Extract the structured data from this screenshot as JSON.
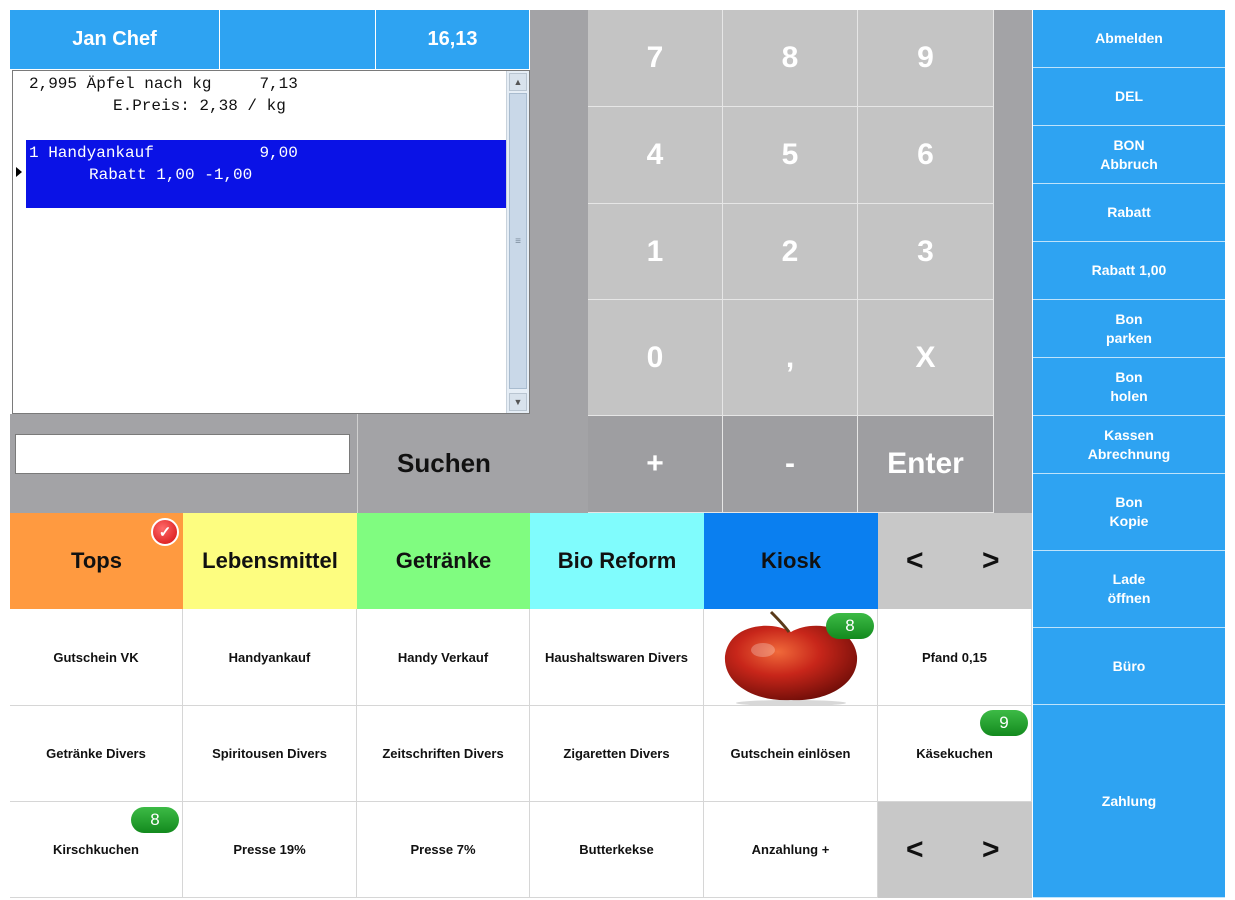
{
  "header": {
    "user": "Jan Chef",
    "total": "16,13"
  },
  "receipt": {
    "lines": [
      {
        "text": "2,995 Äpfel nach kg     7,13",
        "sub": "E.Preis: 2,38 / kg"
      },
      {
        "text": "1 Handyankauf           9,00",
        "sub": "Rabatt 1,00 -1,00"
      }
    ]
  },
  "search": {
    "value": "",
    "button": "Suchen"
  },
  "keypad": {
    "rows": [
      [
        "7",
        "8",
        "9"
      ],
      [
        "4",
        "5",
        "6"
      ],
      [
        "1",
        "2",
        "3"
      ],
      [
        "0",
        ",",
        "X"
      ],
      [
        "+",
        "-",
        "Enter"
      ]
    ]
  },
  "side_buttons": [
    "Abmelden",
    "DEL",
    "BON\nAbbruch",
    "Rabatt",
    "Rabatt 1,00",
    "Bon\nparken",
    "Bon\nholen",
    "Kassen\nAbrechnung",
    "Bon\nKopie",
    "Lade\nöffnen",
    "Büro",
    "Zahlung"
  ],
  "categories": [
    {
      "label": "Tops",
      "color": "#ff9a40"
    },
    {
      "label": "Lebensmittel",
      "color": "#fdfd80"
    },
    {
      "label": "Getränke",
      "color": "#80fc80"
    },
    {
      "label": "Bio Reform",
      "color": "#80fcfd"
    },
    {
      "label": "Kiosk",
      "color": "#0a7ff0"
    }
  ],
  "nav": {
    "prev": "<",
    "next": ">"
  },
  "products": {
    "row1": [
      "Gutschein VK",
      "Handyankauf",
      "Handy Verkauf",
      "Haushaltswaren Divers",
      "",
      "Pfand 0,15"
    ],
    "row2": [
      "Getränke Divers",
      "Spiritousen Divers",
      "Zeitschriften Divers",
      "Zigaretten Divers",
      "Gutschein einlösen",
      "Käsekuchen"
    ],
    "row3": [
      "Kirschkuchen",
      "Presse 19%",
      "Presse 7%",
      "Butterkekse",
      "Anzahlung +"
    ]
  },
  "badges": {
    "apple": "8",
    "kaesekuchen": "9",
    "kirschkuchen": "8"
  },
  "icons": {
    "selected_marker": "check-icon",
    "apple": "apple-image",
    "row_pointer": "row-pointer-icon"
  }
}
